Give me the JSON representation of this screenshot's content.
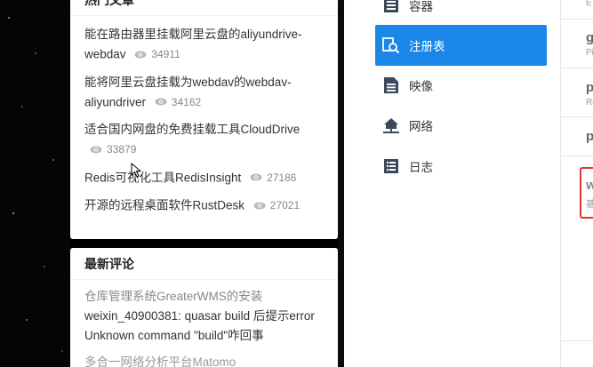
{
  "hot_articles": {
    "title": "热门文章",
    "items": [
      {
        "title": "能在路由器里挂载阿里云盘的aliyundrive-webdav",
        "views": "34911"
      },
      {
        "title": "能将阿里云盘挂载为webdav的webdav-aliyundriver",
        "views": "34162"
      },
      {
        "title": "适合国内网盘的免费挂载工具CloudDrive",
        "views": "33879"
      },
      {
        "title": "Redis可视化工具RedisInsight",
        "views": "27186"
      },
      {
        "title": "开源的远程桌面软件RustDesk",
        "views": "27021"
      }
    ]
  },
  "latest_comments": {
    "title": "最新评论",
    "items": [
      {
        "article": "仓库管理系统GreaterWMS的安装",
        "text": "weixin_40900381: quasar build 后提示error Unknown command \"build\"咋回事"
      },
      {
        "article": "多合一网络分析平台Matomo",
        "text": ""
      }
    ]
  },
  "nav": {
    "items": [
      {
        "label": "容器",
        "icon": "container-icon"
      },
      {
        "label": "注册表",
        "icon": "registry-icon",
        "active": true
      },
      {
        "label": "映像",
        "icon": "image-icon"
      },
      {
        "label": "网络",
        "icon": "network-icon"
      },
      {
        "label": "日志",
        "icon": "log-icon"
      }
    ]
  },
  "right_panel": {
    "rows": [
      {
        "letter": "g",
        "sub": "Pi"
      },
      {
        "letter": "p",
        "sub": "Re"
      },
      {
        "letter": "p",
        "sub": ""
      },
      {
        "letter": "w",
        "sub": "基"
      }
    ],
    "top_sub": "E"
  },
  "colors": {
    "accent": "#1a87e8",
    "highlight": "#e63232"
  }
}
